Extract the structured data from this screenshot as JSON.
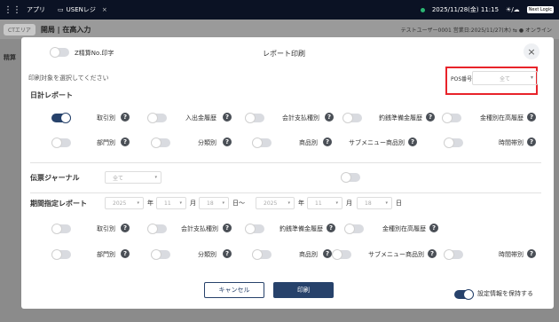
{
  "topbar": {
    "apps_label": "アプリ",
    "tab_label": "USENレジ",
    "tab_close": "×",
    "datetime": "2025/11/28(金) 11:15",
    "logo_text": "Next Logic"
  },
  "bgapp": {
    "pill": "CTエリア",
    "title": "開局 | 在高入力",
    "info": "テストユーザー0001 営業日:2025/11/27(木) ⇆ ● オンライン",
    "side": "精算"
  },
  "modal": {
    "title": "レポート印刷",
    "close": "×",
    "z_print_label": "Z精算No.印字",
    "instruction": "印刷対象を選択してください",
    "pos": {
      "label": "POS番号",
      "value": "全て"
    },
    "daily": {
      "title": "日計レポート",
      "row1": [
        {
          "label": "取引別",
          "on": true
        },
        {
          "label": "入出金履歴",
          "on": false
        },
        {
          "label": "会計支払種別",
          "on": false
        },
        {
          "label": "釣銭準備金履歴",
          "on": false
        },
        {
          "label": "金種別在高履歴",
          "on": false
        }
      ],
      "row2": [
        {
          "label": "部門別"
        },
        {
          "label": "分類別"
        },
        {
          "label": "商品別"
        },
        {
          "label": "サブメニュー商品別"
        },
        {
          "label": "時間帯別"
        }
      ]
    },
    "journal": {
      "title": "伝票ジャーナル",
      "value": "全て"
    },
    "period": {
      "title": "期間指定レポート",
      "from": {
        "year": "2025",
        "month": "11",
        "day": "18"
      },
      "to": {
        "year": "2025",
        "month": "11",
        "day": "18"
      },
      "units": {
        "year": "年",
        "month": "月",
        "day": "日",
        "tilde": "日～"
      },
      "row1": [
        {
          "label": "取引別"
        },
        {
          "label": "会計支払種別"
        },
        {
          "label": "釣銭準備金履歴"
        },
        {
          "label": "金種別在高履歴"
        }
      ],
      "row2": [
        {
          "label": "部門別"
        },
        {
          "label": "分類別"
        },
        {
          "label": "商品別"
        },
        {
          "label": "サブメニュー商品別"
        },
        {
          "label": "時間帯別"
        }
      ]
    },
    "cancel_label": "キャンセル",
    "print_label": "印刷",
    "keep_settings_label": "設定情報を保持する",
    "help_glyph": "?"
  }
}
